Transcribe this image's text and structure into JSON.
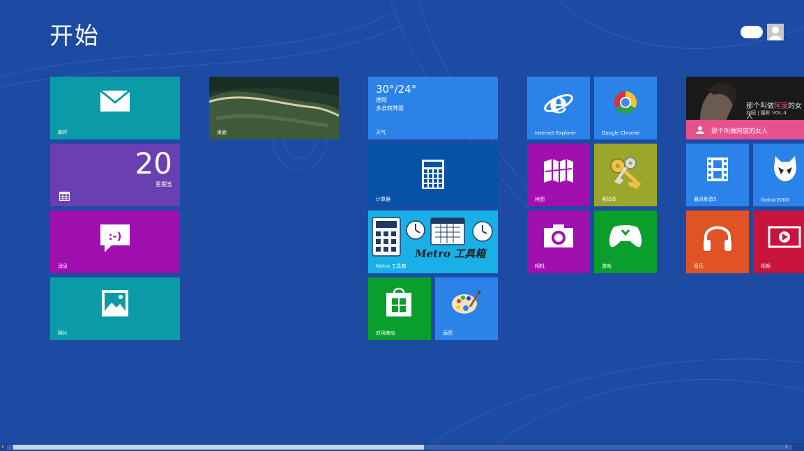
{
  "start": {
    "title": "开始"
  },
  "tiles": {
    "mail": {
      "label": "邮件"
    },
    "calendar": {
      "label": "",
      "day": "20",
      "weekday": "星期五"
    },
    "messaging": {
      "label": "消息"
    },
    "photos": {
      "label": "照片"
    },
    "desktop": {
      "label": "桌面"
    },
    "weather": {
      "temp": "30°/24°",
      "city": "德阳",
      "condition": "多云转阵雨",
      "label": "天气"
    },
    "calculator": {
      "label": "计算器"
    },
    "metro_toolbox": {
      "label": "Metro 工具箱",
      "overlay_text": "Metro 工具箱"
    },
    "store": {
      "label": "应用商店"
    },
    "paint": {
      "label": "画图"
    },
    "ie": {
      "label": "Internet Explorer"
    },
    "chrome": {
      "label": "Google Chrome"
    },
    "maps": {
      "label": "地图"
    },
    "keys": {
      "label": "密码本"
    },
    "camera": {
      "label": "相机"
    },
    "games": {
      "label": "游戏"
    },
    "ad": {
      "title": "那个叫做",
      "highlight": "阿度",
      "title_end": "的女人",
      "subtitle": "刘园 | 摄影 VOL.4",
      "band_text": "那个叫做阿度的女人"
    },
    "video_player": {
      "label": "暴风影音5"
    },
    "foobar": {
      "label": "foobar2000"
    },
    "music": {
      "label": "音乐"
    },
    "video": {
      "label": "视频"
    }
  },
  "colors": {
    "background": "#1d4ba3",
    "teal": "#0b9aa8",
    "purple": "#6a3fb2",
    "magenta": "#a20fb0",
    "blue": "#2b83ea",
    "darkblue": "#0552a8",
    "green": "#0a9e2c",
    "olive": "#9aa72a",
    "orange": "#e05324",
    "crimson": "#c8133c",
    "pink": "#e8508e"
  },
  "icons": {
    "mail": "envelope-icon",
    "calendar": "calendar-grid-icon",
    "messaging": "smiley-chat-icon",
    "photos": "landscape-photo-icon",
    "calculator": "calculator-icon",
    "store": "shopping-bag-icon",
    "paint": "palette-icon",
    "ie": "internet-explorer-icon",
    "chrome": "chrome-icon",
    "maps": "folded-map-icon",
    "keys": "keys-icon",
    "camera": "camera-icon",
    "games": "game-controller-icon",
    "video_player": "film-icon",
    "foobar": "alien-icon",
    "music": "headphones-icon",
    "video": "play-icon"
  }
}
